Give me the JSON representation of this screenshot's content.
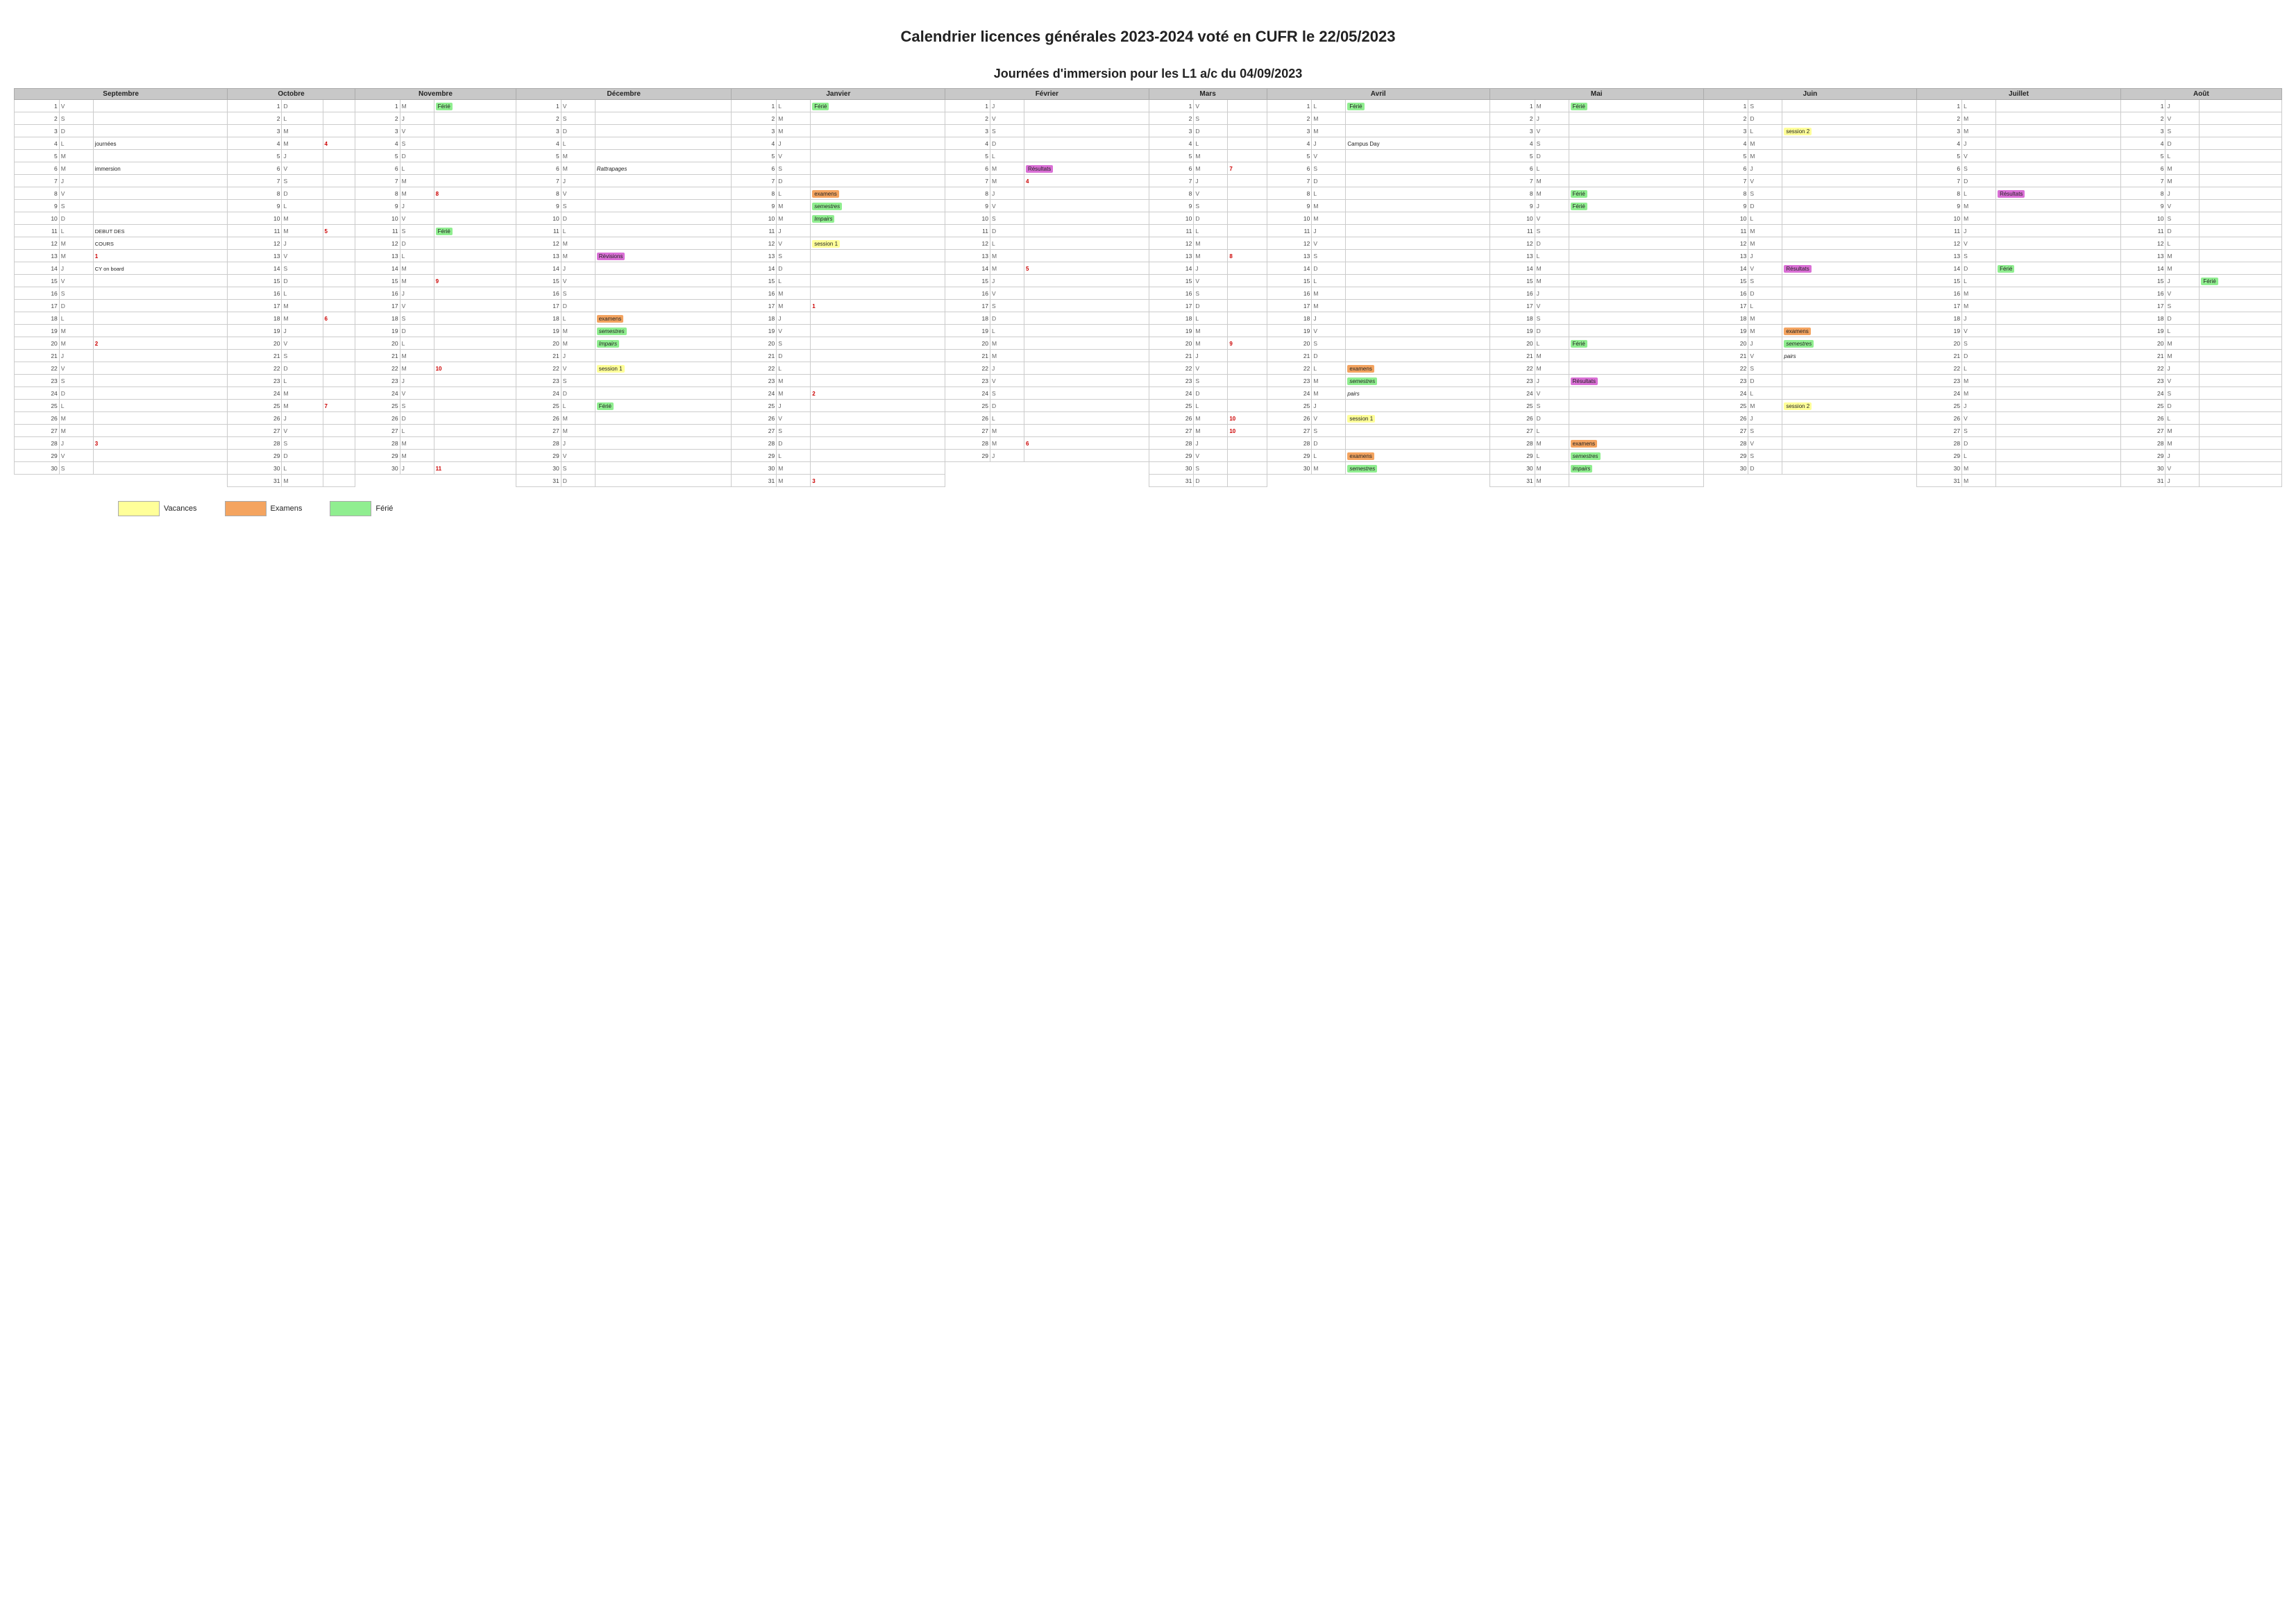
{
  "title": "Calendrier licences générales 2023-2024 voté en CUFR le 22/05/2023",
  "subtitle": "Journées d'immersion pour les L1 a/c du 04/09/2023",
  "months": [
    "Septembre",
    "Octobre",
    "Novembre",
    "Décembre",
    "Janvier",
    "Février",
    "Mars",
    "Avril",
    "Mai",
    "Juin",
    "Juillet",
    "Août"
  ],
  "legend": {
    "vacances": "Vacances",
    "examens": "Examens",
    "ferie": "Férié"
  }
}
